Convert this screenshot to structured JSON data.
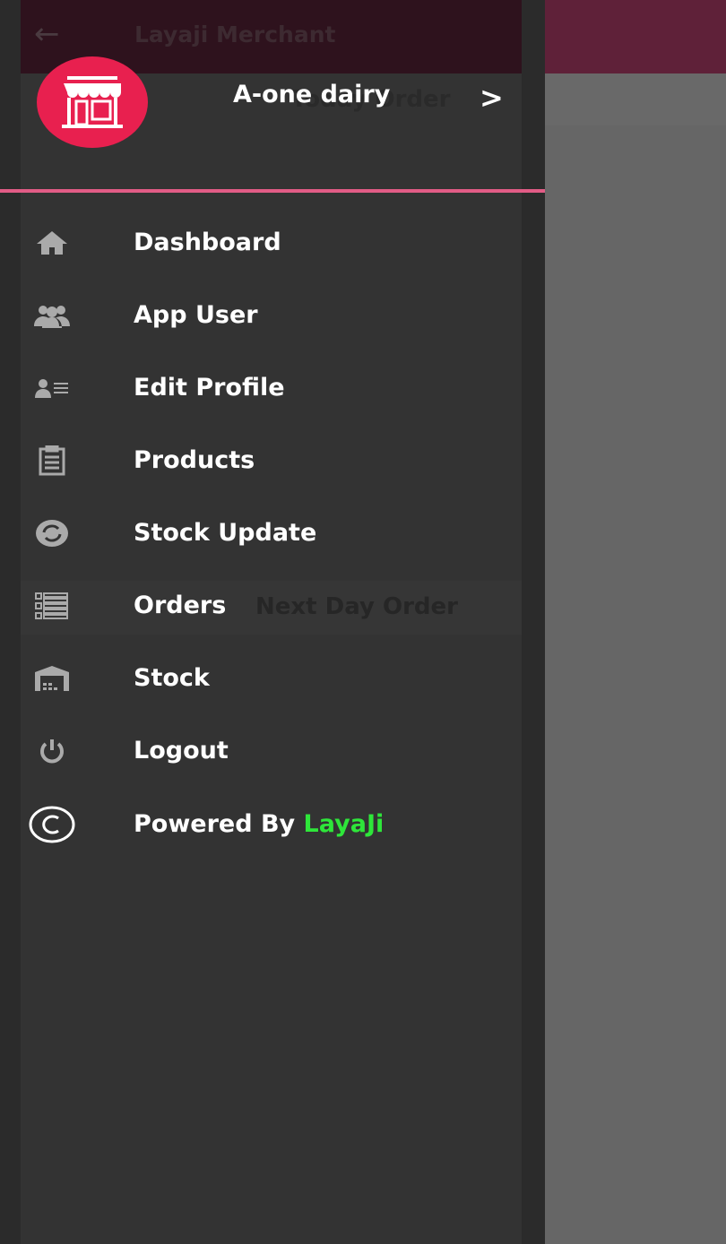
{
  "background_app": {
    "title": "Layaji Merchant",
    "today_tab": "Today Order",
    "next_day_tab": "Next Day Order"
  },
  "drawer": {
    "store_name": "A-one dairy",
    "items": [
      {
        "label": "Dashboard",
        "icon": "home-icon"
      },
      {
        "label": "App User",
        "icon": "users-icon"
      },
      {
        "label": "Edit Profile",
        "icon": "profile-card-icon"
      },
      {
        "label": "Products",
        "icon": "clipboard-icon"
      },
      {
        "label": "Stock Update",
        "icon": "refresh-icon"
      },
      {
        "label": "Orders",
        "icon": "list-icon"
      },
      {
        "label": "Stock",
        "icon": "warehouse-icon"
      },
      {
        "label": "Logout",
        "icon": "power-icon"
      }
    ],
    "powered_by": "Powered By ",
    "brand": "LayaJi"
  },
  "colors": {
    "accent": "#e8204f",
    "divider": "#e25c86",
    "brand": "#2ee63a",
    "appbar": "#5f2139"
  }
}
